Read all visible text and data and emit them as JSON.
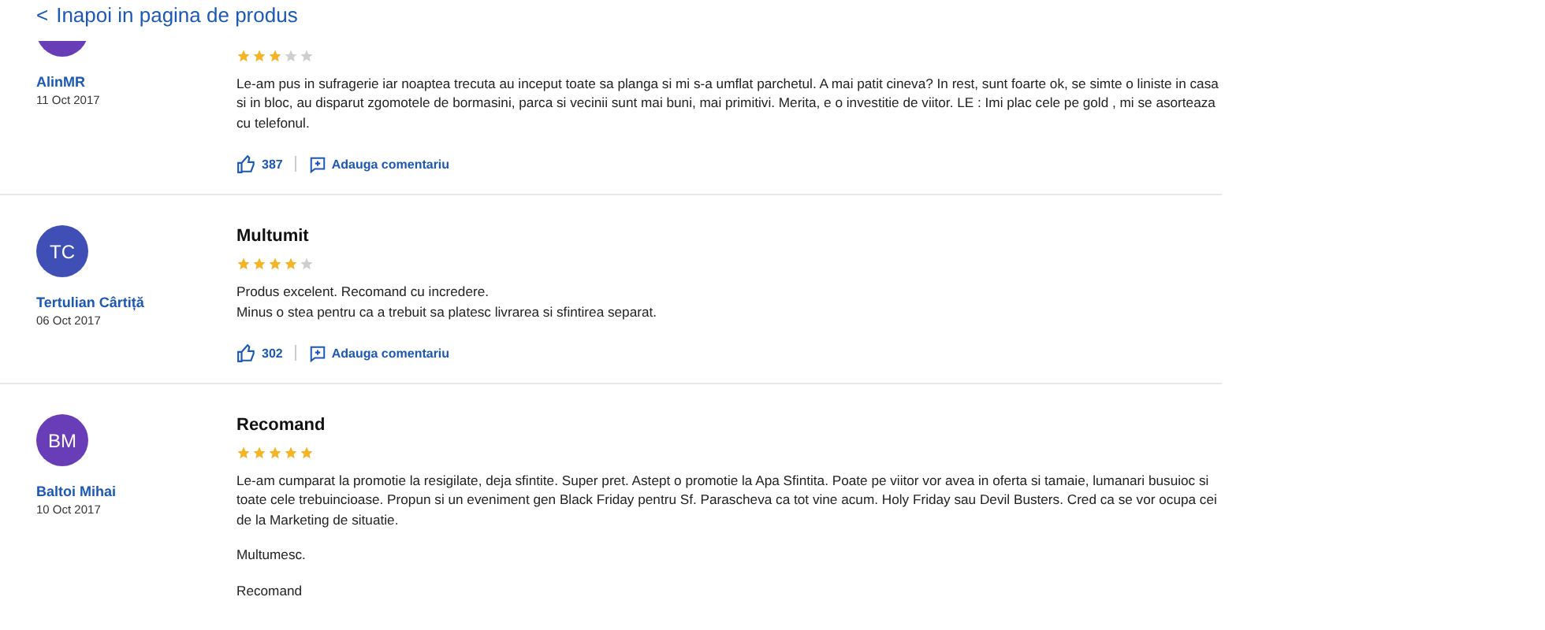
{
  "back_link": {
    "icon": "<",
    "label": "Inapoi in pagina de produs"
  },
  "reviews": [
    {
      "color": "#6a3db8",
      "author": "AlinMR",
      "date": "11 Oct 2017",
      "stars": 3,
      "paragraphs": [
        "Le-am pus in sufragerie iar noaptea trecuta au inceput toate sa planga si mi s-a umflat parchetul. A mai patit cineva? In rest, sunt foarte ok, se simte o liniste in casa si in bloc, au disparut zgomotele de bormasini, parca si vecinii sunt mai buni, mai primitivi. Merita, e o investitie de viitor. LE : Imi plac cele pe gold , mi se asorteaza cu telefonul."
      ],
      "likes": "387",
      "comment_label": "Adauga comentariu"
    },
    {
      "initials": "TC",
      "color": "#3f4fb5",
      "author": "Tertulian Cârtiță",
      "date": "06 Oct 2017",
      "title": "Multumit",
      "stars": 4,
      "paragraphs": [
        "Produs excelent. Recomand cu incredere.\nMinus o stea pentru ca a trebuit sa platesc livrarea si sfintirea separat."
      ],
      "likes": "302",
      "comment_label": "Adauga comentariu"
    },
    {
      "initials": "BM",
      "color": "#6a3db8",
      "author": "Baltoi Mihai",
      "date": "10 Oct 2017",
      "title": "Recomand",
      "stars": 5,
      "paragraphs": [
        "Le-am cumparat la promotie la resigilate, deja sfintite. Super pret. Astept o promotie la Apa Sfintita. Poate pe viitor vor avea in oferta si tamaie, lumanari busuioc si toate cele trebuincioase. Propun si un eveniment gen Black Friday pentru Sf. Parascheva ca tot vine acum. Holy Friday sau Devil Busters. Cred ca se vor ocupa cei de la Marketing de situatie.",
        "Multumesc.",
        "Recomand"
      ]
    }
  ]
}
